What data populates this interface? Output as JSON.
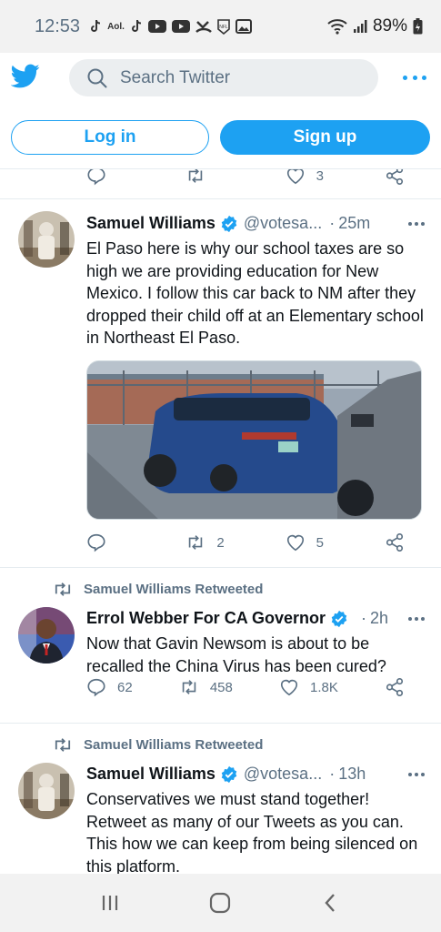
{
  "status_bar": {
    "time": "12:53",
    "notification_icons": [
      "tiktok-icon",
      "aol-icon",
      "tiktok-icon",
      "youtube-icon",
      "youtube-icon",
      "missed-call-icon",
      "nfl-icon",
      "image-icon"
    ],
    "aol_label": "Aol.",
    "battery": "89%"
  },
  "header": {
    "search_placeholder": "Search Twitter",
    "login_label": "Log in",
    "signup_label": "Sign up",
    "brand_color": "#1da1f2"
  },
  "top_actions": {
    "reply_count": "",
    "retweet_count": "",
    "like_count": "3"
  },
  "tweets": [
    {
      "retweeted_by": "",
      "name": "Samuel Williams",
      "handle": "@votesa...",
      "time": "25m",
      "text": "El Paso here is why our school taxes are so high we are providing education for New Mexico. I follow this car back to NM after they dropped their child off at an Elementary school in Northeast El Paso.",
      "reply_count": "",
      "retweet_count": "2",
      "like_count": "5"
    },
    {
      "retweeted_by": "Samuel Williams Retweeted",
      "name": "Errol Webber For CA Governor",
      "handle": "",
      "time": "2h",
      "text": "Now that Gavin Newsom is about to be recalled the China Virus has been cured?",
      "reply_count": "62",
      "retweet_count": "458",
      "like_count": "1.8K"
    },
    {
      "retweeted_by": "Samuel Williams Retweeted",
      "name": "Samuel Williams",
      "handle": "@votesa...",
      "time": "13h",
      "text": "Conservatives we must stand together! Retweet as many of our Tweets as you can. This how we can keep from being silenced on this platform."
    }
  ]
}
